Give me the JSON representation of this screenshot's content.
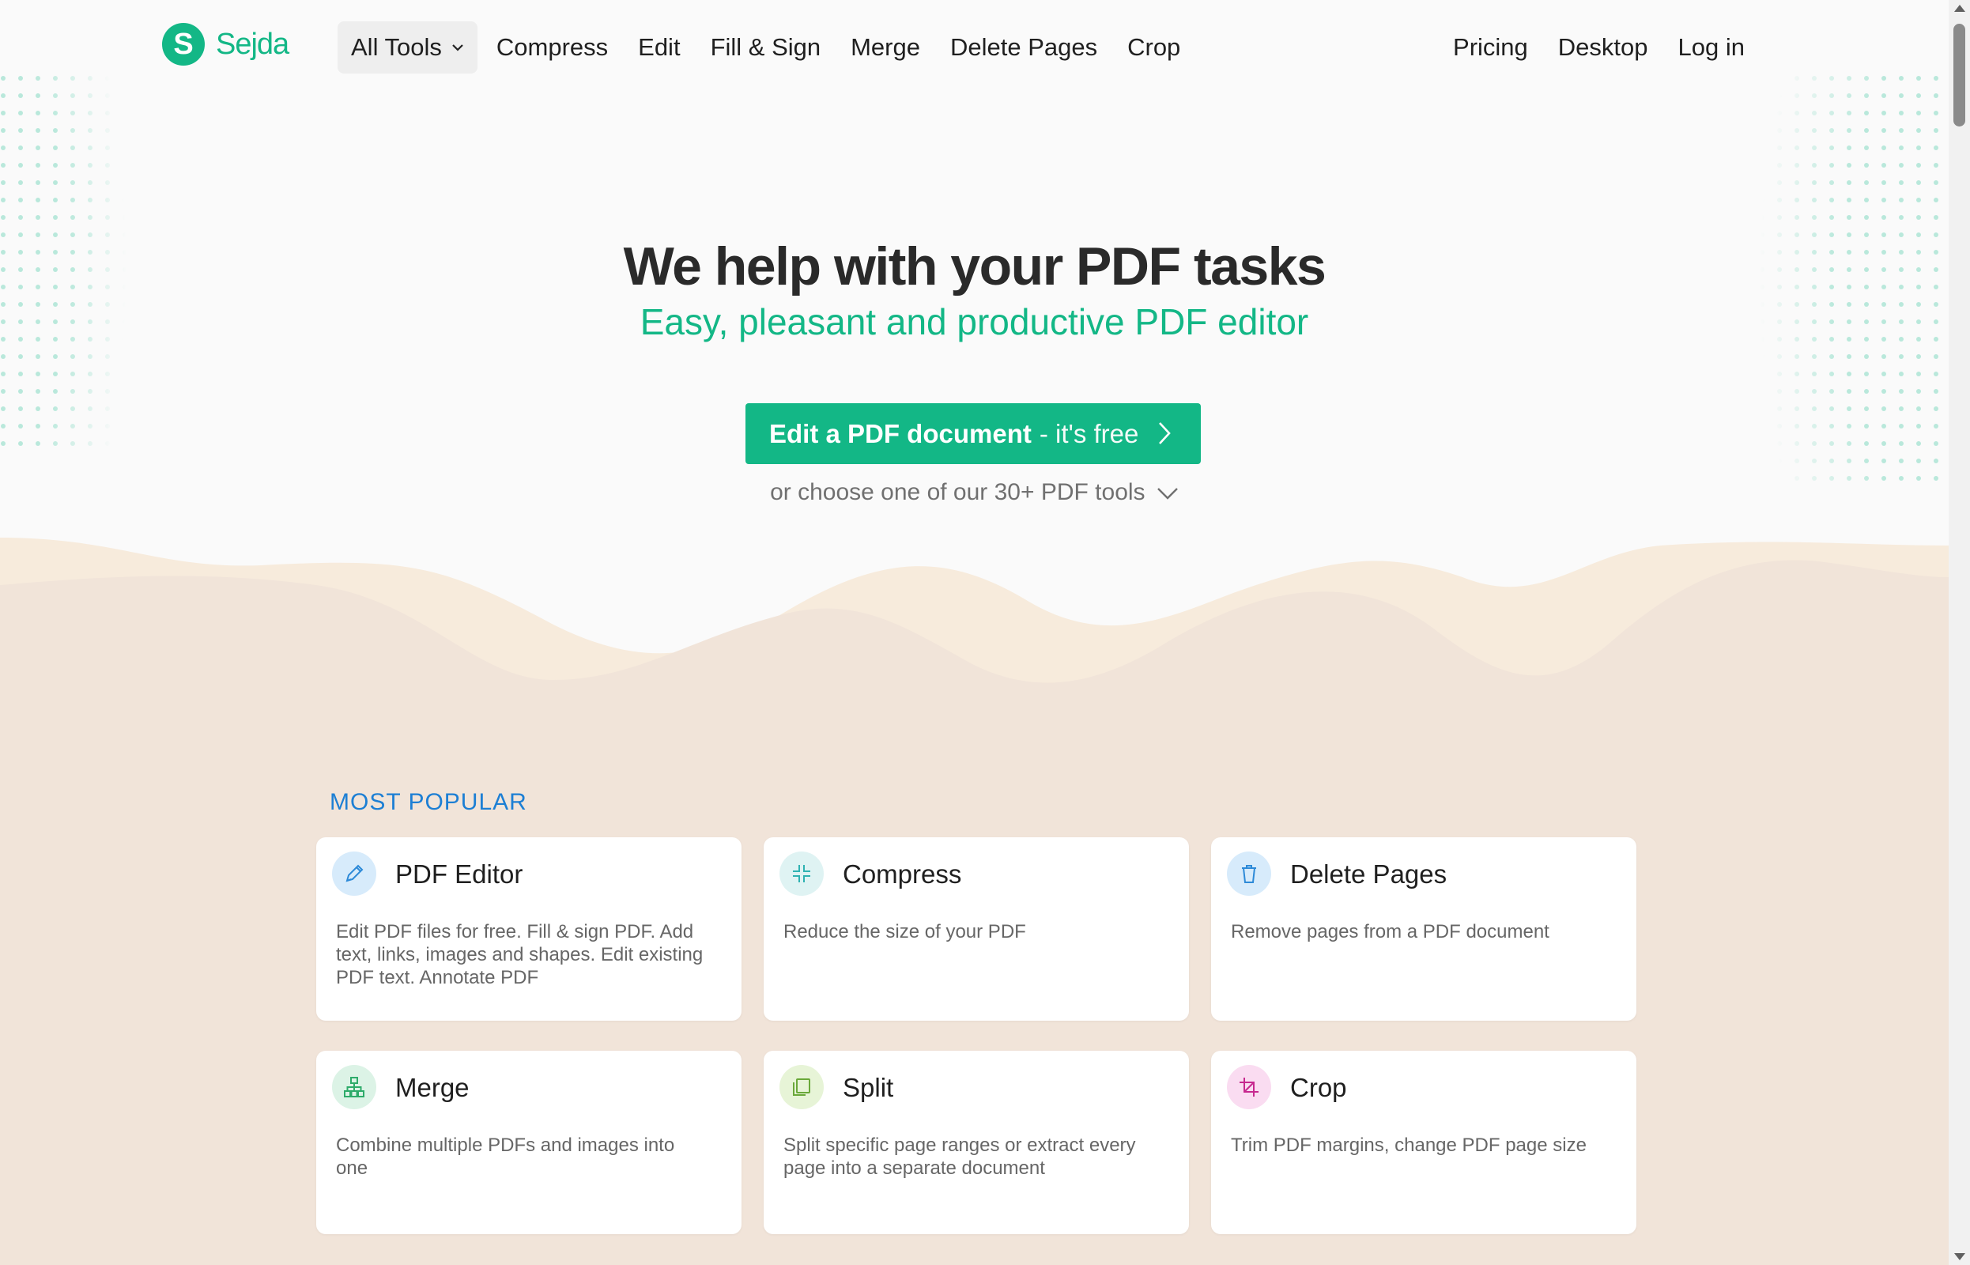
{
  "brand": {
    "logo_letter": "S",
    "name": "Sejda",
    "color": "#13b786"
  },
  "nav": {
    "all_tools": "All Tools",
    "links": [
      "Compress",
      "Edit",
      "Fill & Sign",
      "Merge",
      "Delete Pages",
      "Crop"
    ],
    "right": [
      "Pricing",
      "Desktop",
      "Log in"
    ]
  },
  "hero": {
    "title": "We help with your PDF tasks",
    "subtitle": "Easy, pleasant and productive PDF editor",
    "cta_strong": "Edit a PDF document",
    "cta_rest": "- it's free",
    "choose": "or choose one of our 30+ PDF tools"
  },
  "popular": {
    "label": "MOST POPULAR",
    "cards": [
      {
        "title": "PDF Editor",
        "desc": "Edit PDF files for free. Fill & sign PDF. Add text, links, images and shapes. Edit existing PDF text. Annotate PDF",
        "icon": "pencil-icon",
        "icon_bg": "#d7ebfb",
        "icon_color": "#2d8ad8"
      },
      {
        "title": "Compress",
        "desc": "Reduce the size of your PDF",
        "icon": "compress-icon",
        "icon_bg": "#dff3f3",
        "icon_color": "#2fb2b2"
      },
      {
        "title": "Delete Pages",
        "desc": "Remove pages from a PDF document",
        "icon": "trash-icon",
        "icon_bg": "#d7ebfb",
        "icon_color": "#2d8ad8"
      },
      {
        "title": "Merge",
        "desc": "Combine multiple PDFs and images into one",
        "icon": "merge-icon",
        "icon_bg": "#dcf3e6",
        "icon_color": "#2eab6a"
      },
      {
        "title": "Split",
        "desc": "Split specific page ranges or extract every page into a separate document",
        "icon": "split-icon",
        "icon_bg": "#e7f4d7",
        "icon_color": "#6aa83a"
      },
      {
        "title": "Crop",
        "desc": "Trim PDF margins, change PDF page size",
        "icon": "crop-icon",
        "icon_bg": "#fadcf1",
        "icon_color": "#c7288f"
      }
    ]
  }
}
